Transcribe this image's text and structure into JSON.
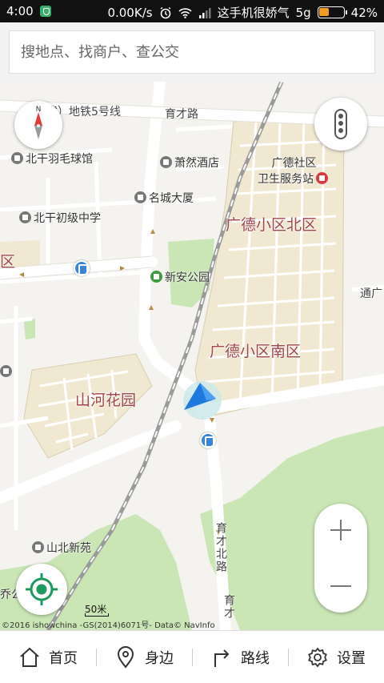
{
  "statusbar": {
    "time": "4:00",
    "network_speed": "0.00K/s",
    "carrier": "这手机很娇气",
    "signal": "5g",
    "battery_percent": "42%",
    "battery_level": 0.42,
    "icons": [
      "app-shield-icon",
      "alarm-icon",
      "wifi-icon",
      "signal-icon",
      "battery-icon"
    ]
  },
  "search": {
    "placeholder": "搜地点、找商户、查公交"
  },
  "map": {
    "areas": [
      "广德小区北区",
      "广德小区南区",
      "山河花园"
    ],
    "roads": [
      "在建）地铁5号线",
      "育才路",
      "育才北路",
      "育才",
      "通广"
    ],
    "pois": [
      "北干羽毛球馆",
      "萧然酒店",
      "广德社区",
      "卫生服务站",
      "名城大厦",
      "北干初级中学",
      "新安公园",
      "山北新苑"
    ],
    "edge_labels": [
      "区",
      "乔公"
    ],
    "scale_label": "50米",
    "copyright": "©2016 ishowchina -GS(2014)6071号- Data© NavInfo",
    "colors": {
      "residential": "#f1e8d2",
      "park": "#c9e6b4",
      "road": "#ffffff",
      "subway": "#9a9a9a",
      "location": "#1f7ae0"
    }
  },
  "controls": {
    "compass_icon": "compass-icon",
    "traffic_icon": "traffic-light-icon",
    "locate_icon": "locate-target-icon",
    "zoom_in_icon": "plus-icon",
    "zoom_out_icon": "minus-icon"
  },
  "nav": {
    "home": "首页",
    "nearby": "身边",
    "route": "路线",
    "settings": "设置"
  }
}
